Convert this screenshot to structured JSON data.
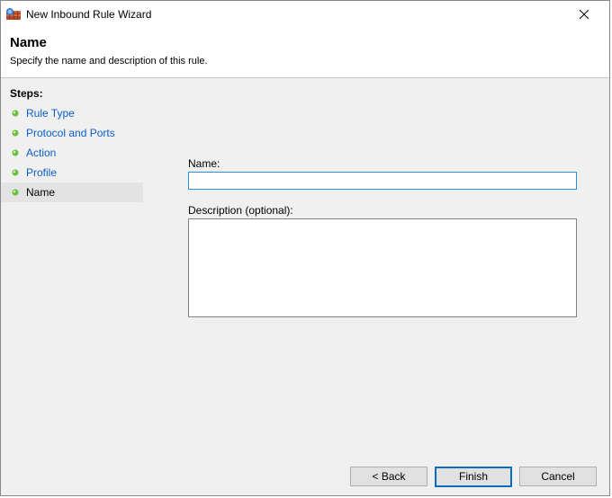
{
  "window": {
    "title": "New Inbound Rule Wizard"
  },
  "header": {
    "title": "Name",
    "subtitle": "Specify the name and description of this rule."
  },
  "sidebar": {
    "heading": "Steps:",
    "items": [
      {
        "label": "Rule Type"
      },
      {
        "label": "Protocol and Ports"
      },
      {
        "label": "Action"
      },
      {
        "label": "Profile"
      },
      {
        "label": "Name"
      }
    ],
    "current_index": 4
  },
  "form": {
    "name_label": "Name:",
    "name_value": "",
    "description_label": "Description (optional):",
    "description_value": ""
  },
  "buttons": {
    "back": "< Back",
    "finish": "Finish",
    "cancel": "Cancel"
  }
}
